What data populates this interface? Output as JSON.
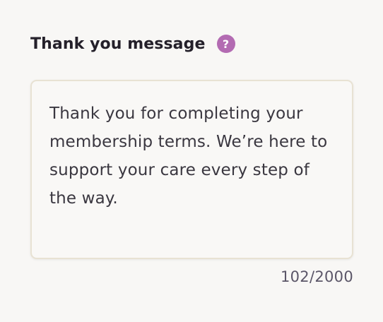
{
  "field": {
    "label": "Thank you message",
    "help_icon": "question-icon",
    "help_glyph": "?",
    "help_color": "#b36bb2",
    "value": "Thank you for completing your membership terms. We’re here to support your care every step of the way.",
    "char_count": "102/2000"
  }
}
